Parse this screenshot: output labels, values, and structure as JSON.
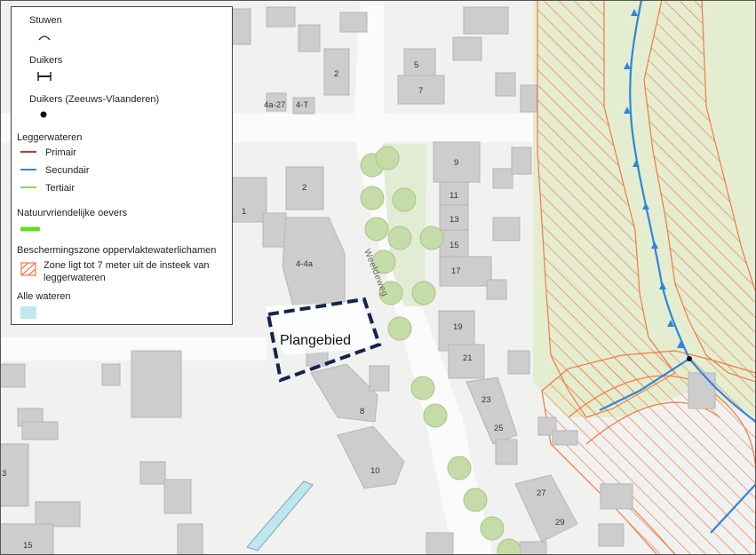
{
  "legend": {
    "stuwen": "Stuwen",
    "duikers": "Duikers",
    "duikers_zv": "Duikers (Zeeuws-Vlaanderen)",
    "leggerwateren": "Leggerwateren",
    "primair": "Primair",
    "secundair": "Secundair",
    "tertiair": "Tertiair",
    "natuurvriendelijke": "Natuurvriendelijke oevers",
    "beschermingszone": "Beschermingszone oppervlaktewaterlichamen",
    "zone_line1": "Zone ligt tot 7 meter uit de insteek van",
    "zone_line2": "leggerwateren",
    "alle_wateren": "Alle wateren"
  },
  "colors": {
    "primair": "#c0392b",
    "secundair": "#2e86de",
    "tertiair": "#7ed957",
    "natuurvriendelijk": "#5ee01c",
    "zone": "#f07a45",
    "alle_wateren": "#bfe7ef",
    "plan_border": "#13234f"
  },
  "map": {
    "street_label": "Weeldeweg",
    "plan_label": "Plangebied",
    "house_numbers": {
      "n2a": "2",
      "n5": "5",
      "n7": "7",
      "n4a27": "4a-27",
      "n4t": "4-T",
      "n9": "9",
      "n11": "11",
      "n13": "13",
      "n15": "15",
      "n17": "17",
      "n2b": "2",
      "n1": "1",
      "n44a": "4-4a",
      "n19": "19",
      "n21": "21",
      "n8": "8",
      "n23": "23",
      "n25": "25",
      "n10": "10",
      "n27": "27",
      "n29": "29",
      "n3": "3",
      "n15b": "15"
    }
  }
}
